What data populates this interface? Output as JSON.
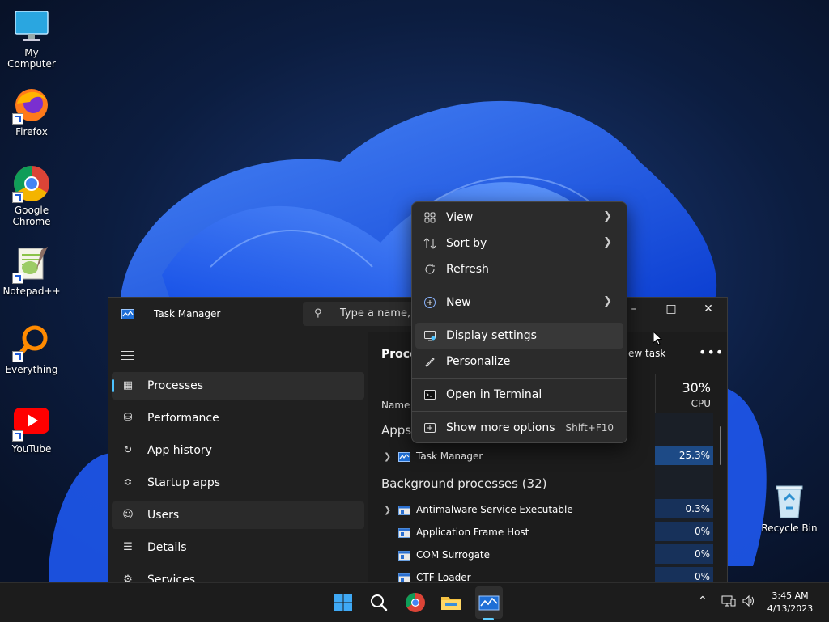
{
  "desktop": {
    "icons": [
      {
        "label": "My Computer",
        "icon": "monitor-icon"
      },
      {
        "label": "Firefox",
        "icon": "firefox-icon"
      },
      {
        "label": "Google Chrome",
        "icon": "chrome-icon"
      },
      {
        "label": "Notepad++",
        "icon": "notepadpp-icon"
      },
      {
        "label": "Everything",
        "icon": "everything-search-icon"
      },
      {
        "label": "YouTube",
        "icon": "youtube-icon"
      }
    ],
    "recycle_bin": {
      "label": "Recycle Bin",
      "icon": "recycle-bin-icon"
    }
  },
  "task_manager": {
    "title": "Task Manager",
    "search_placeholder": "Type a name, p",
    "nav": [
      {
        "label": "Processes",
        "icon": "processes-icon"
      },
      {
        "label": "Performance",
        "icon": "performance-icon"
      },
      {
        "label": "App history",
        "icon": "app-history-icon"
      },
      {
        "label": "Startup apps",
        "icon": "startup-icon"
      },
      {
        "label": "Users",
        "icon": "users-icon"
      },
      {
        "label": "Details",
        "icon": "details-icon"
      },
      {
        "label": "Services",
        "icon": "services-icon"
      }
    ],
    "page_title": "Proces",
    "run_new_task": "n new task",
    "more": "•••",
    "columns": {
      "name": "Name",
      "cpu_pct": "30%",
      "cpu": "CPU"
    },
    "apps_label": "Apps",
    "apps": [
      {
        "name": "Task Manager",
        "cpu": "25.3%"
      }
    ],
    "background_label": "Background processes (32)",
    "background": [
      {
        "name": "Antimalware Service Executable",
        "cpu": "0.3%",
        "expandable": true
      },
      {
        "name": "Application Frame Host",
        "cpu": "0%",
        "expandable": false
      },
      {
        "name": "COM Surrogate",
        "cpu": "0%",
        "expandable": false
      },
      {
        "name": "CTF Loader",
        "cpu": "0%",
        "expandable": false
      }
    ]
  },
  "context_menu": {
    "items": [
      {
        "label": "View",
        "icon": "view-grid-icon",
        "submenu": true
      },
      {
        "label": "Sort by",
        "icon": "sort-icon",
        "submenu": true
      },
      {
        "label": "Refresh",
        "icon": "refresh-icon",
        "submenu": false
      },
      {
        "label": "New",
        "icon": "new-plus-icon",
        "submenu": true
      },
      {
        "label": "Display settings",
        "icon": "display-settings-icon",
        "submenu": false
      },
      {
        "label": "Personalize",
        "icon": "personalize-pen-icon",
        "submenu": false
      },
      {
        "label": "Open in Terminal",
        "icon": "terminal-icon",
        "submenu": false
      },
      {
        "label": "Show more options",
        "icon": "more-options-icon",
        "shortcut": "Shift+F10"
      }
    ]
  },
  "taskbar": {
    "time": "3:45 AM",
    "date": "4/13/2023"
  },
  "colors": {
    "accent": "#60cdff",
    "selection": "#4cc2ff",
    "cpu_high": "#1d4a86",
    "cpu_low": "#17315a"
  }
}
